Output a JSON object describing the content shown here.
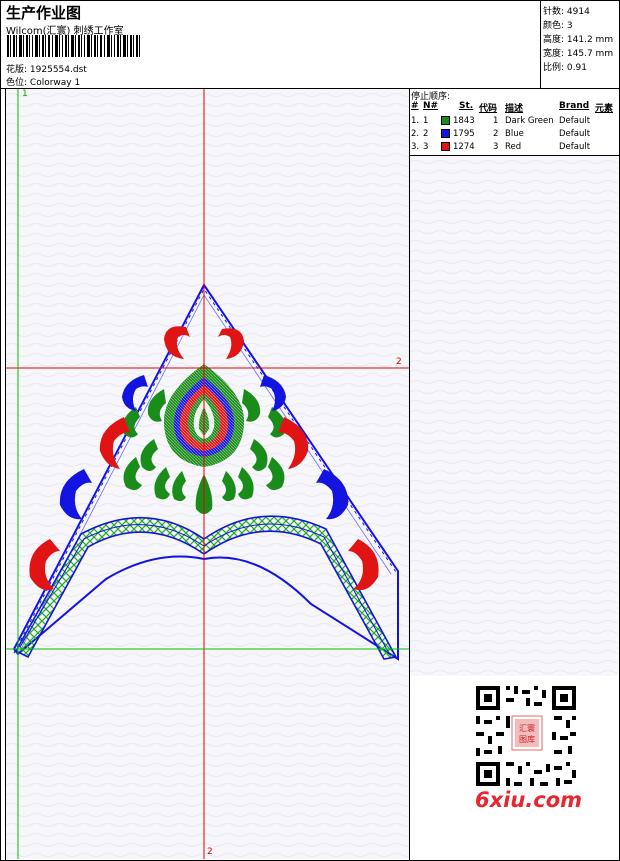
{
  "header": {
    "title": "生产作业图",
    "subtitle": "Wilcom(汇寰) 刺绣工作室",
    "design_label": "花版:",
    "design_value": "1925554.dst",
    "colorway_label": "色位:",
    "colorway_value": "Colorway 1"
  },
  "stats": [
    {
      "label": "针数:",
      "value": "4914"
    },
    {
      "label": "颜色:",
      "value": "3"
    },
    {
      "label": "高度:",
      "value": "141.2 mm"
    },
    {
      "label": "宽度:",
      "value": "145.7 mm"
    },
    {
      "label": "比例:",
      "value": "0.91"
    }
  ],
  "stop_sequence": {
    "title": "停止顺序:",
    "headers": {
      "num": "#",
      "no": "N#",
      "st": "St.",
      "code": "代码",
      "desc": "描述",
      "brand": "Brand",
      "element": "元素"
    },
    "rows": [
      {
        "num": "1.",
        "no": "1",
        "color": "#1a8c1a",
        "st": "1843",
        "code": "1",
        "desc": "Dark Green",
        "brand": "Default"
      },
      {
        "num": "2.",
        "no": "2",
        "color": "#1414e0",
        "st": "1795",
        "code": "2",
        "desc": "Blue",
        "brand": "Default"
      },
      {
        "num": "3.",
        "no": "3",
        "color": "#e01414",
        "st": "1274",
        "code": "3",
        "desc": "Red",
        "brand": "Default"
      }
    ]
  },
  "axes": {
    "green_top_label": "1",
    "red_right_label": "2",
    "red_bottom_label": "2"
  },
  "watermark": {
    "text": "6xiu.com",
    "seal_text": "汇寰图库"
  },
  "colors": {
    "green": "#1a8c1a",
    "blue": "#1414e0",
    "red": "#e01414",
    "guide_red": "#e00000",
    "guide_green": "#00c000"
  }
}
